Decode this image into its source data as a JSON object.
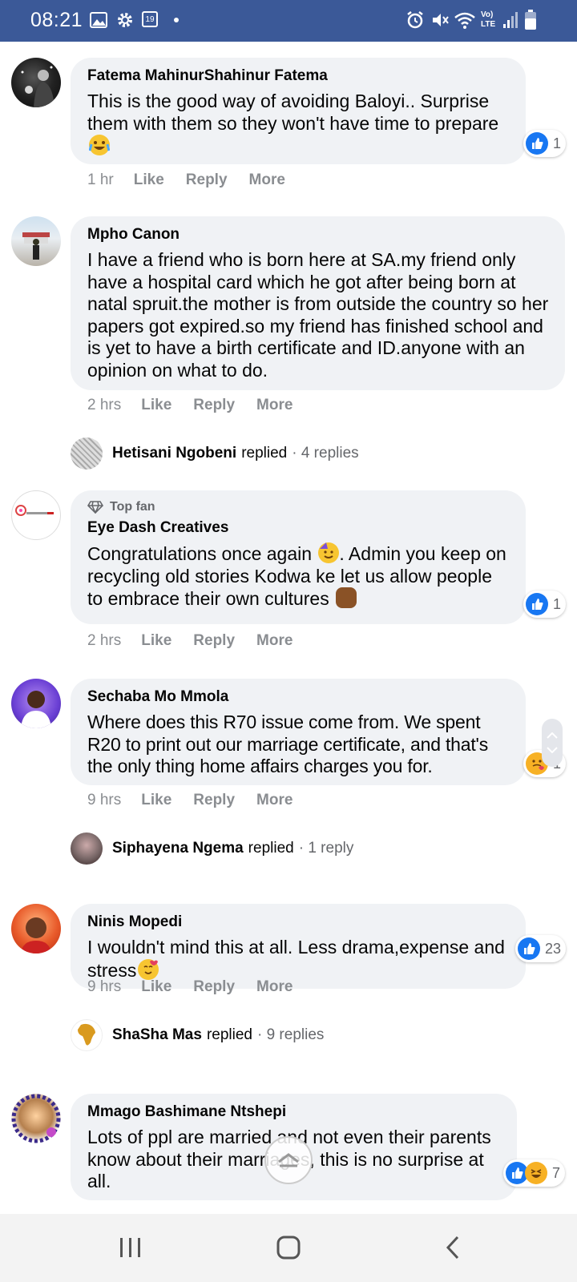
{
  "status_bar": {
    "time": "08:21",
    "calendar_day": "19",
    "network": "Vo) LTE"
  },
  "comments": [
    {
      "author": "Fatema MahinurShahinur Fatema",
      "text": "This is the good way of avoiding Baloyi.. Surprise them with them so they won't have time to prepare",
      "emoji": "joy-emoji",
      "time": "1 hr",
      "reactions": {
        "types": [
          "like"
        ],
        "count": "1"
      }
    },
    {
      "author": "Mpho Canon",
      "text": "I have a friend who is born here at SA.my friend only have a hospital card which he got after being born at natal spruit.the mother is from outside the country so her papers got expired.so my friend has finished school and is yet to have a birth certificate and ID.anyone with an opinion on what to do.",
      "time": "2 hrs",
      "replies": {
        "name": "Hetisani Ngobeni",
        "verb": "replied",
        "count": "· 4 replies"
      }
    },
    {
      "badge": "Top fan",
      "author": "Eye Dash Creatives",
      "text_before": "Congratulations once again ",
      "text_mid": ". Admin you keep on recycling old stories Kodwa ke let us allow people to embrace their own cultures ",
      "time": "2 hrs",
      "reactions": {
        "types": [
          "like"
        ],
        "count": "1"
      }
    },
    {
      "author": "Sechaba Mo Mmola",
      "text": "Where does this R70 issue come from. We spent R20 to print out our marriage certificate, and that's the only thing home affairs charges you for.",
      "time": "9 hrs",
      "reactions": {
        "types": [
          "care"
        ],
        "count": "1"
      },
      "replies": {
        "name": "Siphayena Ngema",
        "verb": "replied",
        "count": "· 1 reply"
      }
    },
    {
      "author": "Ninis Mopedi",
      "text": "I wouldn't mind this at all. Less drama,expense and stress",
      "time": "9 hrs",
      "reactions": {
        "types": [
          "like"
        ],
        "count": "23"
      },
      "replies": {
        "name": "ShaSha Mas",
        "verb": "replied",
        "count": "· 9 replies"
      }
    },
    {
      "author": "Mmago Bashimane Ntshepi",
      "text": "Lots of ppl are married and not even their parents know about their marriages, this is no surprise at all.",
      "reactions": {
        "types": [
          "like",
          "haha"
        ],
        "count": "7"
      }
    }
  ],
  "actions": {
    "like": "Like",
    "reply": "Reply",
    "more": "More"
  },
  "colors": {
    "status_bar": "#3b5998",
    "bubble": "#f0f2f5",
    "like_blue": "#1877f2",
    "muted": "#65676b"
  }
}
